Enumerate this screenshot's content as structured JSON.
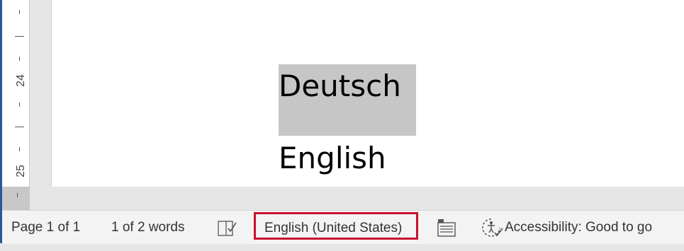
{
  "ruler": {
    "mark_24": "24",
    "mark_25": "25"
  },
  "document": {
    "lines": [
      "Deutsch",
      "English"
    ]
  },
  "status_bar": {
    "page_info": "Page 1 of 1",
    "word_count": "1 of 2 words",
    "proofing_icon": "proofing-book-check-icon",
    "language": "English (United States)",
    "display_settings_icon": "display-settings-icon",
    "accessibility_icon": "accessibility-checker-icon",
    "accessibility": "Accessibility: Good to go"
  },
  "colors": {
    "accent": "#2b579a",
    "highlight_box": "#c8102e",
    "selection": "#c6c6c6"
  }
}
